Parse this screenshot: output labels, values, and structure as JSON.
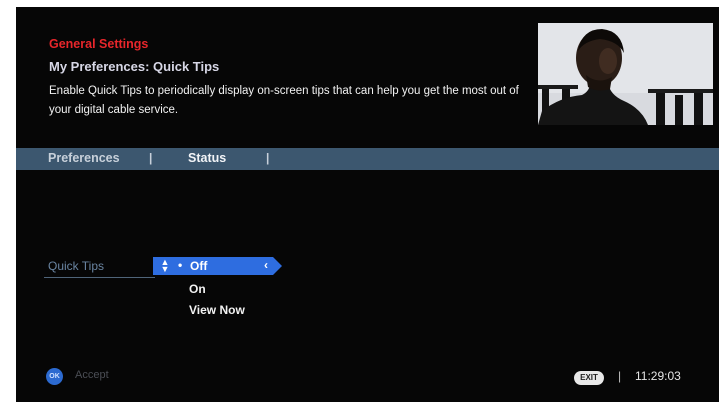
{
  "header": {
    "breadcrumb": "General Settings",
    "subtitle": "My Preferences: Quick Tips",
    "description": "Enable Quick Tips to periodically display on-screen tips that can help you get the most out of your digital cable service."
  },
  "tabs": [
    {
      "label": "Preferences",
      "active": false
    },
    {
      "label": "Status",
      "active": true
    }
  ],
  "tab_separator": "|",
  "setting": {
    "label": "Quick Tips",
    "options": [
      "Off",
      "On",
      "View Now"
    ],
    "selected": "Off"
  },
  "footer": {
    "accept_button": "OK",
    "accept_label": "Accept",
    "exit_button": "EXIT",
    "separator": "|",
    "time": "11:29:03"
  },
  "colors": {
    "accent_red": "#e8262b",
    "tab_bar": "#3c576f",
    "selection": "#2e6de0",
    "background": "#060606"
  },
  "icons": [
    "up-down-arrows-icon",
    "chevron-left-icon",
    "ok-button-icon",
    "exit-button-icon"
  ]
}
